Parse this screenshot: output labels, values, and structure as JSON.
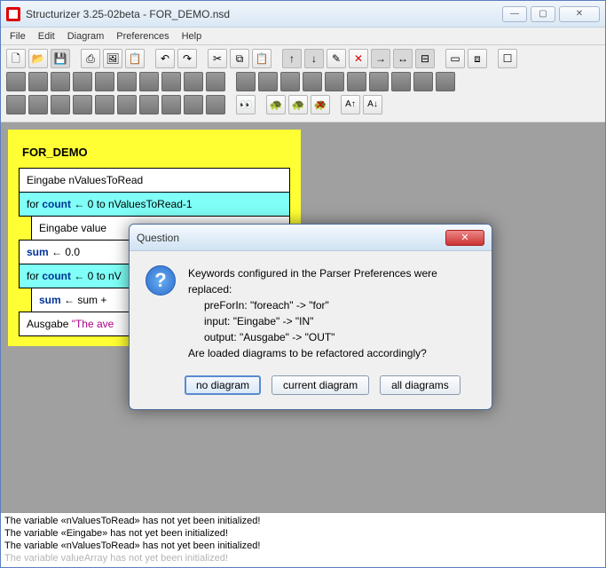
{
  "window": {
    "title": "Structurizer 3.25-02beta - FOR_DEMO.nsd"
  },
  "menu": {
    "file": "File",
    "edit": "Edit",
    "diagram": "Diagram",
    "preferences": "Preferences",
    "help": "Help"
  },
  "icons": {
    "new": "🗋",
    "open": "📂",
    "save": "💾",
    "print": "⎙",
    "picture": "🖼",
    "clipboard": "📋",
    "undo": "↶",
    "redo": "↷",
    "cut": "✂",
    "copy": "⧉",
    "paste": "📋",
    "arrow_up": "↑",
    "arrow_down": "↓",
    "tool": "✎",
    "x": "✕",
    "arrow_r1": "→",
    "arrow_r2": "↔",
    "box1": "▭",
    "box2": "⧈",
    "box3": "☐",
    "eyes": "👀",
    "turtle1": "🐢",
    "turtle2": "🐢",
    "turtle_x": "🐢",
    "font_up": "A↑",
    "font_dn": "A↓"
  },
  "diagram": {
    "title": "FOR_DEMO",
    "b1": "Eingabe nValuesToRead",
    "b2_pre": "for ",
    "b2_kw": "count",
    "b2_post": " ← 0 to nValuesToRead-1",
    "b3": "Eingabe value",
    "b4_kw": "sum",
    "b4_post": " ← 0.0",
    "b5_pre": "for ",
    "b5_kw": "count",
    "b5_post": " ← 0 to nV",
    "b6_kw": "sum",
    "b6_post": " ← sum +",
    "b7_pre": "Ausgabe ",
    "b7_str": "\"The ave"
  },
  "dialog": {
    "title": "Question",
    "line1": "Keywords configured in the Parser Preferences were replaced:",
    "line2": "preForIn: \"foreach\" -> \"for\"",
    "line3": "input: \"Eingabe\" -> \"IN\"",
    "line4": "output: \"Ausgabe\" -> \"OUT\"",
    "line5": "Are loaded diagrams to be refactored accordingly?",
    "btn_none": "no diagram",
    "btn_current": "current diagram",
    "btn_all": "all diagrams"
  },
  "log": {
    "l1": "The variable «nValuesToRead» has not yet been initialized!",
    "l2": "The variable «Eingabe» has not yet been initialized!",
    "l3": "The variable «nValuesToRead» has not yet been initialized!",
    "l4": "The variable  valueArray  has not yet been initialized!"
  }
}
